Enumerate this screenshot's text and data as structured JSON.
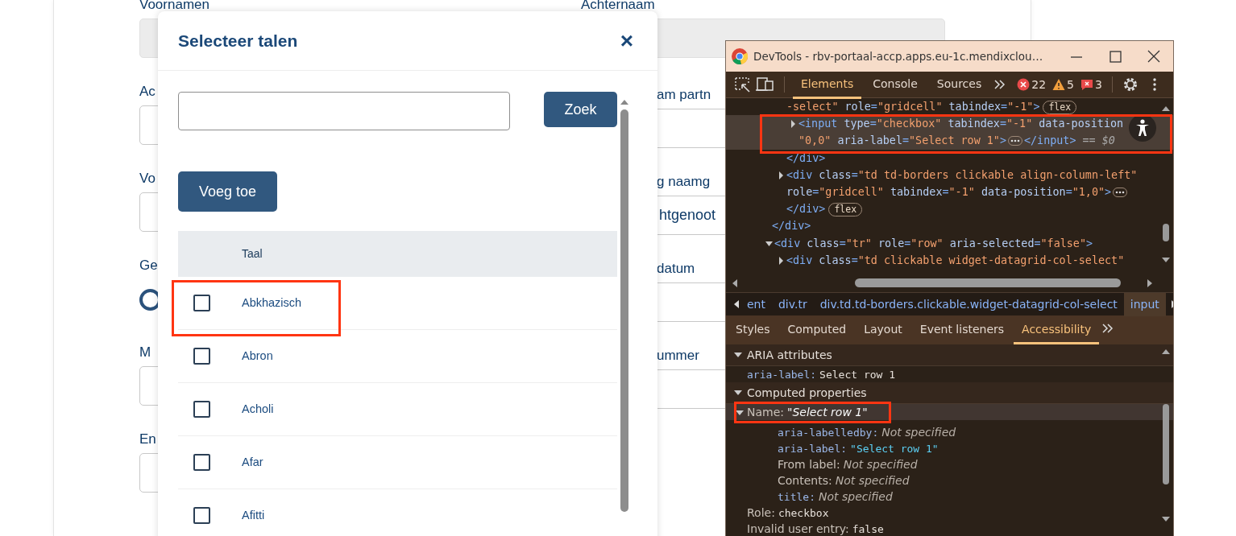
{
  "form": {
    "left_column": [
      {
        "label": "Voornamen",
        "kind": "field",
        "disabled": true
      },
      {
        "label": "Ac",
        "kind": "field",
        "disabled": false
      },
      {
        "label": "Vo",
        "kind": "field",
        "disabled": false
      },
      {
        "label": "Ge",
        "kind": "radio",
        "checked": false
      },
      {
        "label": "M",
        "kind": "field",
        "disabled": false
      },
      {
        "label": "En",
        "kind": "field",
        "disabled": false
      }
    ],
    "right_column": [
      {
        "label": "Achternaam",
        "kind": "field",
        "disabled": true
      },
      {
        "label": "am partn",
        "kind": "field",
        "disabled": false
      },
      {
        "label": "g naamg",
        "kind": "field",
        "disabled": false,
        "value": "htgenoot"
      },
      {
        "label": "datum",
        "kind": "field",
        "disabled": false
      },
      {
        "label": "ummer",
        "kind": "field",
        "disabled": false
      }
    ]
  },
  "modal": {
    "title": "Selecteer talen",
    "close": "×",
    "search_button": "Zoek",
    "add_button": "Voeg toe",
    "table": {
      "columns": [
        "Taal"
      ],
      "rows": [
        {
          "name": "Abkhazisch",
          "checked": false
        },
        {
          "name": "Abron",
          "checked": false
        },
        {
          "name": "Acholi",
          "checked": false
        },
        {
          "name": "Afar",
          "checked": false
        },
        {
          "name": "Afitti",
          "checked": false
        }
      ]
    }
  },
  "devtools": {
    "title": "DevTools - rbv-portaal-accp.apps.eu-1c.mendixclou…",
    "tabs": [
      {
        "label": "Elements",
        "selected": true
      },
      {
        "label": "Console",
        "selected": false
      },
      {
        "label": "Sources",
        "selected": false
      }
    ],
    "errors": "22",
    "warnings": "5",
    "issues": "3",
    "tree": [
      {
        "children": [
          {
            "lines": [
              "-select\" role=\"gridcell\" tabindex=\"-1\">"
            ],
            "badge": "flex",
            "children": [
              {
                "lines": [
                  "<input type=\"checkbox\" tabindex=\"-1\" data-position",
                  "\"0,0\" aria-label=\"Select row 1\">"
                ],
                "expanded": false,
                "selected": true,
                "ellipsis": true,
                "suffix": "</input>",
                "marker": "== $0"
              }
            ],
            "close": "</div>"
          },
          {
            "lines": [
              "<div class=\"td td-borders clickable align-column-left\"",
              "role=\"gridcell\" tabindex=\"-1\" data-position=\"1,0\">"
            ],
            "expanded": false,
            "ellipsis": true,
            "close": "</div>",
            "close_badge": "flex"
          }
        ],
        "close": "</div>"
      },
      {
        "lines": [
          "<div class=\"tr\" role=\"row\" aria-selected=\"false\">"
        ],
        "expanded": true,
        "children": [
          {
            "lines": [
              "<div class=\"td clickable widget-datagrid-col-select\""
            ],
            "expanded": false
          }
        ]
      }
    ],
    "breadcrumbs": [
      {
        "label": "ent",
        "selected": false
      },
      {
        "label": "div.tr",
        "selected": false
      },
      {
        "label": "div.td.td-borders.clickable.widget-datagrid-col-select",
        "selected": false
      },
      {
        "label": "input",
        "selected": true
      }
    ],
    "subtabs": [
      {
        "label": "Styles",
        "selected": false
      },
      {
        "label": "Computed",
        "selected": false
      },
      {
        "label": "Layout",
        "selected": false
      },
      {
        "label": "Event listeners",
        "selected": false
      },
      {
        "label": "Accessibility",
        "selected": true
      }
    ],
    "accessibility": [
      {
        "title": "ARIA attributes",
        "expanded": true,
        "items": [
          {
            "key": "aria-label:",
            "kind": "aria",
            "value": "Select row 1"
          }
        ]
      },
      {
        "title": "Computed properties",
        "expanded": true,
        "items": [
          {
            "key": "Name:",
            "kind": "name",
            "value": "\"Select row 1\"",
            "expanded": true,
            "selected": true,
            "children": [
              {
                "key": "aria-labelledby:",
                "kind": "attribute-source",
                "specified": false,
                "value": "Not specified"
              },
              {
                "key": "aria-label:",
                "kind": "attribute-source",
                "specified": true,
                "value": "\"Select row 1\""
              },
              {
                "key": "From label:",
                "kind": "label-source",
                "value": "Not specified"
              },
              {
                "key": "Contents:",
                "kind": "label-source",
                "value": "Not specified"
              },
              {
                "key": "title:",
                "kind": "attribute-source",
                "specified": false,
                "value": "Not specified"
              }
            ]
          },
          {
            "key": "Role:",
            "kind": "property",
            "value": "checkbox"
          },
          {
            "key": "Invalid user entry:",
            "kind": "property",
            "value": "false"
          }
        ]
      }
    ]
  }
}
